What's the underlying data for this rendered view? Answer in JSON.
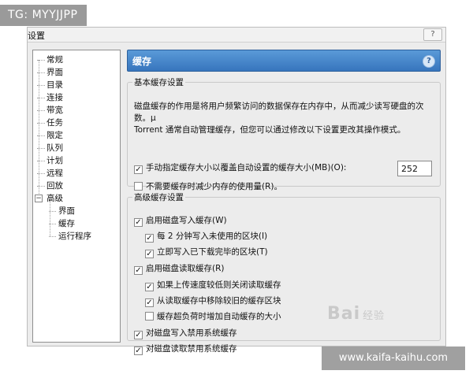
{
  "watermark_top": "TG: MYYJJPP",
  "watermark_bottom": "www.kaifa-kaihu.com",
  "logo_text": "Bai",
  "logo_suffix": "经验",
  "window": {
    "title": "设置",
    "help_label": "?"
  },
  "tree": {
    "items": [
      {
        "label": "常规"
      },
      {
        "label": "界面"
      },
      {
        "label": "目录"
      },
      {
        "label": "连接"
      },
      {
        "label": "带宽"
      },
      {
        "label": "任务"
      },
      {
        "label": "限定"
      },
      {
        "label": "队列"
      },
      {
        "label": "计划"
      },
      {
        "label": "远程"
      },
      {
        "label": "回放"
      },
      {
        "label": "高级",
        "expander": "−"
      },
      {
        "label": "界面"
      },
      {
        "label": "缓存"
      },
      {
        "label": "运行程序"
      }
    ]
  },
  "panel": {
    "title": "缓存",
    "help_label": "?"
  },
  "basic": {
    "legend": "基本缓存设置",
    "description_1": "磁盘缓存的作用是将用户频繁访问的数据保存在内存中，从而减少读写硬盘的次数。µ",
    "description_2": "Torrent 通常自动管理缓存，但您可以通过修改以下设置更改其操作模式。",
    "override_label": "手动指定缓存大小以覆盖自动设置的缓存大小(MB)(O):",
    "override_checked": true,
    "cache_size": "252",
    "reduce_label": "不需要缓存时减少内存的使用量(R)。",
    "reduce_checked": false
  },
  "advanced": {
    "legend": "高级缓存设置",
    "items": [
      {
        "label": "启用磁盘写入缓存(W)",
        "checked": true
      },
      {
        "label": "每 2 分钟写入未使用的区块(I)",
        "checked": true
      },
      {
        "label": "立即写入已下载完毕的区块(T)",
        "checked": true
      },
      {
        "label": "启用磁盘读取缓存(R)",
        "checked": true
      },
      {
        "label": "如果上传速度较低则关闭读取缓存",
        "checked": true
      },
      {
        "label": "从读取缓存中移除较旧的缓存区块",
        "checked": true
      },
      {
        "label": "缓存超负荷时增加自动缓存的大小",
        "checked": false
      },
      {
        "label": "对磁盘写入禁用系统缓存",
        "checked": true
      },
      {
        "label": "对磁盘读取禁用系统缓存",
        "checked": true
      }
    ]
  },
  "check_glyph": "✓"
}
